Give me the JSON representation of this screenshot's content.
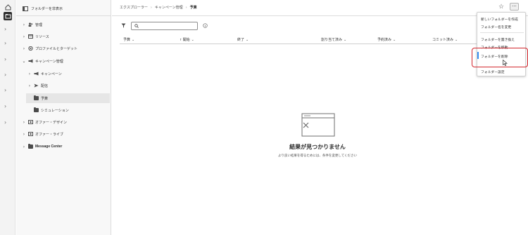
{
  "rail": {
    "icons": [
      "home-icon",
      "folder-icon"
    ]
  },
  "tree": {
    "toggle_label": "フォルダーを非表示",
    "items": [
      {
        "label": "管理",
        "icon": "users-icon",
        "level": 0
      },
      {
        "label": "リソース",
        "icon": "resources-icon",
        "level": 0
      },
      {
        "label": "プロファイルとターゲット",
        "icon": "target-icon",
        "level": 0
      },
      {
        "label": "キャンペーン管理",
        "icon": "megaphone-icon",
        "level": 0
      },
      {
        "label": "キャンペーン",
        "icon": "megaphone-icon",
        "level": 1
      },
      {
        "label": "配信",
        "icon": "send-icon",
        "level": 1
      },
      {
        "label": "予算",
        "icon": "folder-icon",
        "level": 1
      },
      {
        "label": "シミュレーション",
        "icon": "folder-icon",
        "level": 1
      },
      {
        "label": "オファー・デザイン",
        "icon": "offer-icon",
        "level": 0
      },
      {
        "label": "オファー・ライブ",
        "icon": "offer-icon",
        "level": 0
      },
      {
        "label": "Message Center",
        "icon": "folder-icon",
        "level": 0
      }
    ]
  },
  "breadcrumb": {
    "items": [
      "エクスプローラー",
      "キャンペーン管理",
      "予算"
    ],
    "separator": "›"
  },
  "toolbar": {
    "search_placeholder": "",
    "more_label": "···"
  },
  "table": {
    "columns": [
      "予算",
      "開始",
      "終了",
      "割り当て済み",
      "予約済み",
      "コミット済み"
    ]
  },
  "empty_state": {
    "title": "結果が見つかりません",
    "subtitle": "より良い結果を得るためには、条件を変更してください"
  },
  "menu": {
    "items": [
      "新しいフォルダーを作成",
      "フォルダー名を変更",
      "フォルダーを置き換え",
      "フォルダーを移動",
      "フォルダーを削除",
      "フォルダー設定"
    ]
  },
  "colors": {
    "highlight": "#d2232a",
    "accent": "#378ef0"
  }
}
